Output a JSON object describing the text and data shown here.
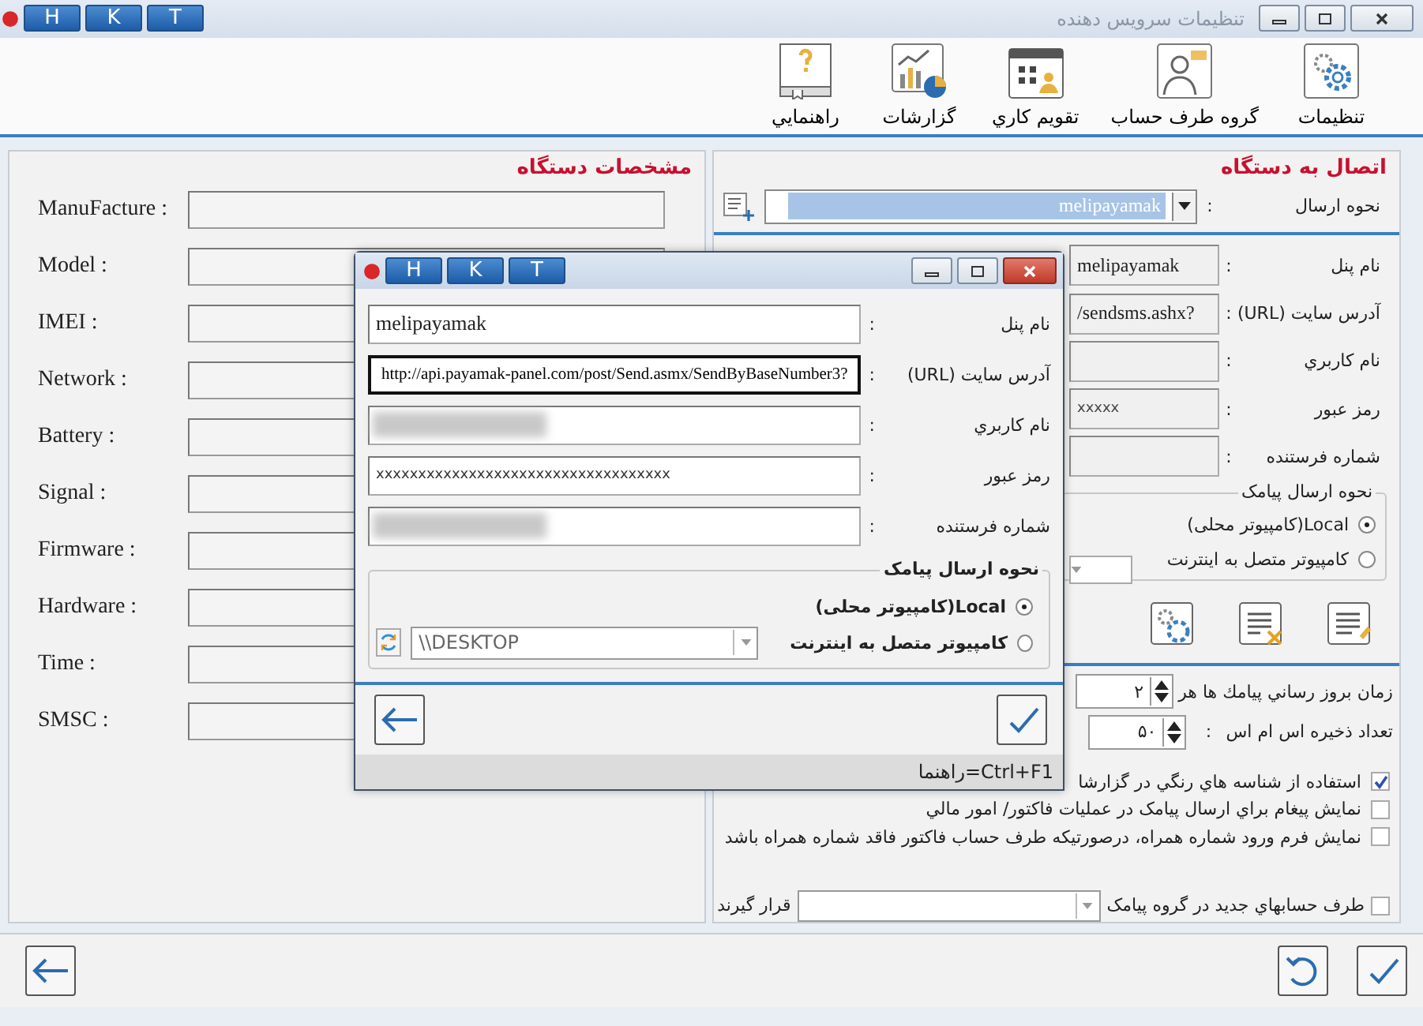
{
  "window": {
    "badges": [
      "T",
      "K",
      "H"
    ],
    "title": "تنظیمات سرویس دهنده"
  },
  "toolbar": [
    {
      "label": "تنظیمات"
    },
    {
      "label": "گروه طرف حساب"
    },
    {
      "label": "تقويم كاري"
    },
    {
      "label": "گزارشات"
    },
    {
      "label": "راهنمايي"
    }
  ],
  "device_panel": {
    "title": "مشخصات دستگاه",
    "fields": [
      "ManuFacture :",
      "Model :",
      "IMEI :",
      "Network :",
      "Battery :",
      "Signal :",
      "Firmware :",
      "Hardware :",
      "Time :",
      "SMSC :"
    ]
  },
  "connection_panel": {
    "title": "اتصال به دستگاه",
    "send_method": {
      "label": "نحوه ارسال",
      "separator": ":",
      "value": "melipayamak"
    },
    "fields": [
      {
        "label": "نام پنل",
        "separator": ":",
        "value": "melipayamak"
      },
      {
        "label": "آدرس سایت (URL)",
        "separator": ":",
        "value": "/sendsms.ashx?"
      },
      {
        "label": "نام کاربري",
        "separator": ":"
      },
      {
        "label": "رمز عبور",
        "separator": ":",
        "value": "xxxxx"
      },
      {
        "label": "شماره فرستنده",
        "separator": ":"
      }
    ],
    "sms_method": {
      "title": "نحوه ارسال پیامک",
      "options": [
        {
          "label": "Local(کامپیوتر محلی)",
          "selected": true
        },
        {
          "label": "کامپیوتر متصل به اینترنت",
          "selected": false
        }
      ]
    },
    "update_interval": {
      "label": "زمان بروز رساني پیامك ها هر",
      "value": "۲"
    },
    "sms_store": {
      "label": "تعداد ذخیره اس ام اس",
      "separator": ":",
      "value": "۵۰"
    },
    "options": [
      {
        "label": "استفاده از شناسه هاي رنگي در گزارشا",
        "checked": true
      },
      {
        "label": "نمایش پیغام براي ارسال پیامک در عملیات فاکتور/ امور مالي",
        "checked": false
      },
      {
        "label": "نمایش فرم ورود شماره همراه، درصورتیکه طرف حساب فاکتور فاقد شماره همراه باشد",
        "checked": false
      }
    ],
    "group_option": {
      "label": "طرف حسابهاي جديد در گروه پیامک",
      "checked": false,
      "suffix": "قرار گیرند"
    }
  },
  "dialog": {
    "badges": [
      "T",
      "K",
      "H"
    ],
    "fields": [
      {
        "label": "نام پنل",
        "separator": ":",
        "value": "melipayamak",
        "focused": false,
        "redacted": false
      },
      {
        "label": "آدرس سایت (URL)",
        "separator": ":",
        "value": "http://api.payamak-panel.com/post/Send.asmx/SendByBaseNumber3?",
        "focused": true,
        "redacted": false
      },
      {
        "label": "نام کاربري",
        "separator": ":",
        "focused": false,
        "redacted": true
      },
      {
        "label": "رمز عبور",
        "separator": ":",
        "value": "xxxxxxxxxxxxxxxxxxxxxxxxxxxxxxxxxxx",
        "focused": false,
        "redacted": false
      },
      {
        "label": "شماره فرستنده",
        "separator": ":",
        "focused": false,
        "redacted": true
      }
    ],
    "sms_method": {
      "title": "نحوه ارسال پیامک",
      "options": [
        {
          "label": "Local(کامپیوتر محلی)",
          "selected": true
        },
        {
          "label": "کامپیوتر متصل به اینترنت",
          "selected": false
        }
      ],
      "server": "\\\\DESKTOP"
    },
    "status": "راهنما=Ctrl+F1"
  }
}
